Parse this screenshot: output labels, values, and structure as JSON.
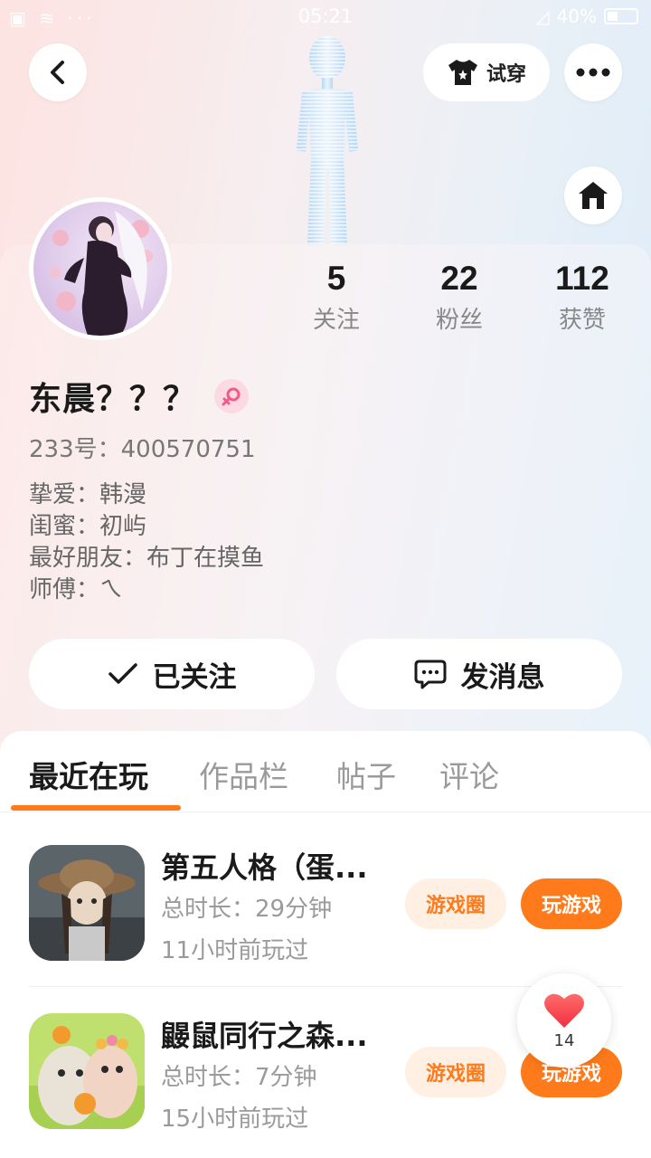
{
  "status_bar": {
    "time": "05:21",
    "battery": "40%"
  },
  "header": {
    "tryon_label": "试穿"
  },
  "profile": {
    "name": "东晨？？？",
    "uid": "233号：400570751",
    "bio": [
      "挚爱：韩漫",
      "闺蜜：初屿",
      "最好朋友：布丁在摸鱼",
      "师傅：ㄟ"
    ],
    "stats": [
      {
        "num": "5",
        "label": "关注"
      },
      {
        "num": "22",
        "label": "粉丝"
      },
      {
        "num": "112",
        "label": "获赞"
      }
    ]
  },
  "actions": {
    "follow_label": "已关注",
    "message_label": "发消息"
  },
  "tabs": [
    "最近在玩",
    "作品栏",
    "帖子",
    "评论"
  ],
  "games": [
    {
      "title": "第五人格（蛋...",
      "duration": "总时长：29分钟",
      "last_played": "11小时前玩过",
      "circle_label": "游戏圈",
      "play_label": "玩游戏"
    },
    {
      "title": "鼹鼠同行之森...",
      "duration": "总时长：7分钟",
      "last_played": "15小时前玩过",
      "circle_label": "游戏圈",
      "play_label": "玩游戏"
    }
  ],
  "like_float": {
    "count": "14"
  },
  "colors": {
    "accent": "#ff7a1a",
    "accent_light": "#fff0e3",
    "gender_bg": "#fcd9e3"
  }
}
